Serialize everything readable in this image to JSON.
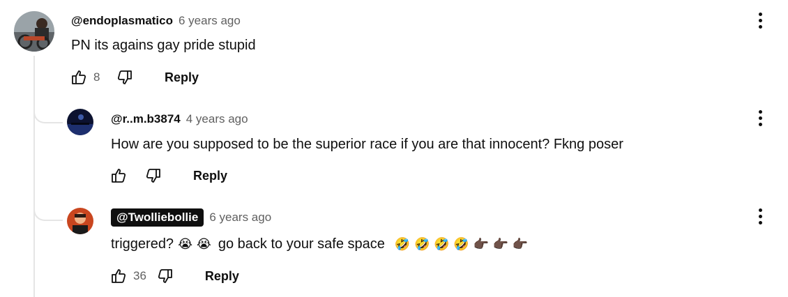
{
  "comments": [
    {
      "author": "@endoplasmatico",
      "time": "6 years ago",
      "text": "PN its agains gay pride stupid",
      "likes": "8",
      "reply_label": "Reply"
    },
    {
      "author": "@r..m.b3874",
      "time": "4 years ago",
      "text": "How are you supposed to be the superior race if you are that innocent? Fkng poser",
      "likes": "",
      "reply_label": "Reply"
    },
    {
      "author": "@Twolliebollie",
      "time": "6 years ago",
      "text": "triggered?",
      "text_emoji_a": "😭 😭",
      "text_b": "go back to your safe space",
      "text_emoji_b": "🤣 🤣 🤣 🤣 👉🏿 👉🏿 👉🏿",
      "likes": "36",
      "reply_label": "Reply"
    }
  ],
  "icons": {
    "like": "thumbs-up-icon",
    "dislike": "thumbs-down-icon",
    "menu": "more-vert-icon"
  },
  "colors": {
    "text": "#0f0f0f",
    "secondary": "#606060",
    "thread_line": "#e5e5e5",
    "badge_bg": "#0f0f0f"
  }
}
